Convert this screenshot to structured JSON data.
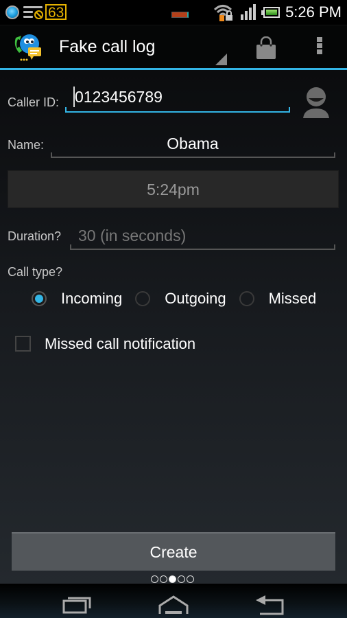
{
  "status_bar": {
    "battery_badge": "63",
    "clock": "5:26 PM",
    "icons": [
      "sync-orb-icon",
      "notification-blocked-icon",
      "battery-badge-icon",
      "media-indicator-icon",
      "wifi-locked-icon",
      "signal-icon",
      "battery-icon"
    ]
  },
  "action_bar": {
    "app_icon": "fake-call-app-icon",
    "title": "Fake call log",
    "actions": [
      "shop-bag-icon",
      "overflow-menu-icon"
    ],
    "accent_color": "#33b5e5"
  },
  "form": {
    "caller_id": {
      "label": "Caller ID:",
      "value": "0123456789",
      "icon": "contact-picker-icon"
    },
    "name": {
      "label": "Name:",
      "value": "Obama"
    },
    "time": {
      "value": "5:24pm"
    },
    "duration": {
      "label": "Duration?",
      "placeholder": "30 (in seconds)",
      "value": ""
    },
    "call_type": {
      "label": "Call type?",
      "options": [
        {
          "label": "Incoming",
          "selected": true
        },
        {
          "label": "Outgoing",
          "selected": false
        },
        {
          "label": "Missed",
          "selected": false
        }
      ]
    },
    "missed_notification": {
      "label": "Missed call notification",
      "checked": false
    }
  },
  "create_button": {
    "label": "Create"
  },
  "pager": {
    "pages": 5,
    "current": 3
  },
  "nav_bar": {
    "buttons": [
      "recent-apps-icon",
      "home-icon",
      "back-icon"
    ]
  }
}
